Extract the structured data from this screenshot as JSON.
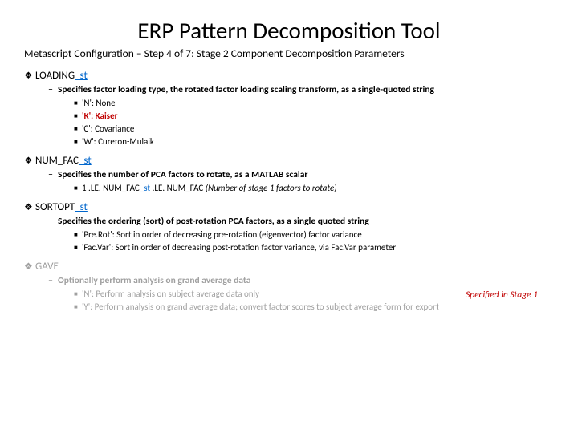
{
  "title": "ERP Pattern Decomposition Tool",
  "subtitle": "Metascript Configuration – Step 4 of 7: Stage 2 Component Decomposition Parameters",
  "sections": [
    {
      "name": "LOADING",
      "suffix": "_st",
      "faded": false,
      "desc": "Specifies factor loading type, the rotated factor loading scaling transform, as a single-quoted string",
      "items": [
        {
          "text": "'N': None",
          "hl": false
        },
        {
          "text": "'K': Kaiser",
          "hl": true
        },
        {
          "text": "'C': Covariance",
          "hl": false
        },
        {
          "text": "'W': Cureton-Mulaik",
          "hl": false
        }
      ]
    },
    {
      "name": "NUM_FAC",
      "suffix": "_st",
      "faded": false,
      "desc": "Specifies the number of PCA factors to rotate, as a MATLAB scalar",
      "items": [
        {
          "html": "1 .LE. NUM_FAC<span class='suffix'>_st</span> .LE. NUM_FAC <i>(Number of stage 1 factors to rotate)</i>"
        }
      ]
    },
    {
      "name": "SORTOPT",
      "suffix": "_st",
      "faded": false,
      "desc": "Specifies the ordering (sort) of post-rotation PCA factors, as a single quoted string",
      "items": [
        {
          "text": "'Pre.Rot': Sort in order of decreasing pre-rotation (eigenvector) factor variance"
        },
        {
          "text": "'Fac.Var': Sort in order of decreasing post-rotation factor variance, via Fac.Var parameter"
        }
      ]
    },
    {
      "name": "GAVE",
      "suffix": "",
      "faded": true,
      "desc": "Optionally perform analysis on grand average data",
      "note": "Specified in Stage 1",
      "items": [
        {
          "text": "'N': Perform analysis on subject average data only"
        },
        {
          "text": "'Y': Perform analysis on grand average data; convert factor scores to subject average form for export"
        }
      ]
    }
  ]
}
